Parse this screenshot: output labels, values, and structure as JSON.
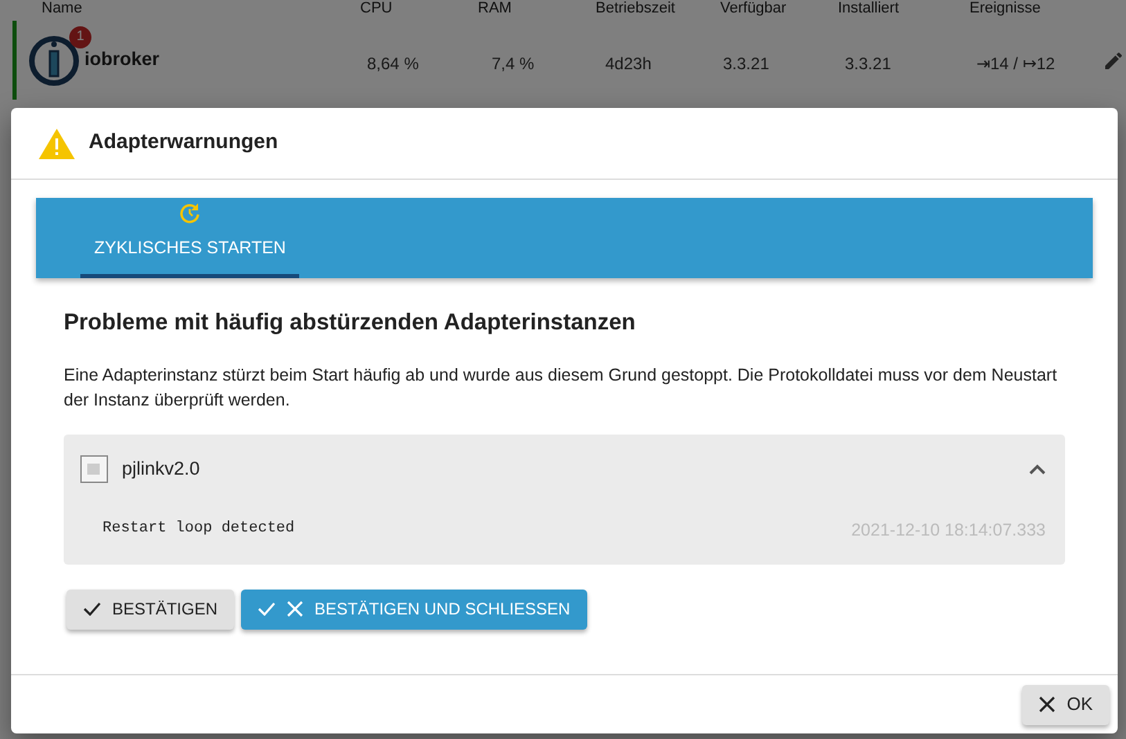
{
  "background": {
    "columns": [
      "Name",
      "CPU",
      "RAM",
      "Betriebszeit",
      "Verfügbar",
      "Installiert",
      "Ereignisse"
    ],
    "row": {
      "badge": "1",
      "name": "iobroker",
      "cells": [
        "8,64 %",
        "7,4 %",
        "4d23h",
        "3.3.21",
        "3.3.21",
        "⇥14 / ↦12"
      ]
    }
  },
  "dialog": {
    "title": "Adapterwarnungen",
    "tabs": [
      {
        "label": "ZYKLISCHES STARTEN",
        "selected": true
      }
    ],
    "heading": "Probleme mit häufig abstürzenden Adapterinstanzen",
    "description": "Eine Adapterinstanz stürzt beim Start häufig ab und wurde aus diesem Grund gestoppt. Die Protokolldatei muss vor dem Neustart der Instanz überprüft werden.",
    "instances": [
      {
        "name": "pjlinkv2.0",
        "expanded": true,
        "message": "Restart loop detected",
        "time": "2021-12-10 18:14:07.333"
      }
    ],
    "buttons": [
      {
        "label": "BESTÄTIGEN",
        "kind": "confirm"
      },
      {
        "label": "BESTÄTIGEN UND SCHLIESSEN",
        "kind": "confirm-close"
      }
    ],
    "footer_button": "OK"
  }
}
